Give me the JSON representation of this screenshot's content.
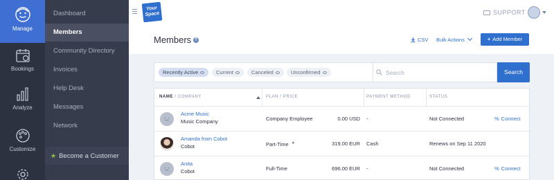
{
  "rail": {
    "items": [
      {
        "label": "Manage",
        "active": true,
        "icon": "face-icon"
      },
      {
        "label": "Bookings",
        "active": false,
        "icon": "calendar-icon"
      },
      {
        "label": "Analyze",
        "active": false,
        "icon": "bar-chart-icon"
      },
      {
        "label": "Customize",
        "active": false,
        "icon": "palette-icon"
      }
    ]
  },
  "sidebar": {
    "items": [
      {
        "label": "Dashboard",
        "active": false
      },
      {
        "label": "Members",
        "active": true
      },
      {
        "label": "Community Directory",
        "active": false
      },
      {
        "label": "Invoices",
        "active": false
      },
      {
        "label": "Help Desk",
        "active": false
      },
      {
        "label": "Messages",
        "active": false
      },
      {
        "label": "Network",
        "active": false
      }
    ],
    "become_customer": "Become a Customer"
  },
  "topbar": {
    "logo_text_line1": "Your",
    "logo_text_line2": "Space",
    "support_label": "SUPPORT"
  },
  "page": {
    "title": "Members",
    "csv_label": "CSV",
    "bulk_label": "Bulk Actions",
    "add_label": "Add Member"
  },
  "filters": {
    "chips": [
      {
        "label": "Recently Active",
        "active": true
      },
      {
        "label": "Current",
        "active": false
      },
      {
        "label": "Canceled",
        "active": false
      },
      {
        "label": "Unconfirmed",
        "active": false
      }
    ],
    "search_placeholder": "Search",
    "search_button": "Search"
  },
  "table": {
    "headers": {
      "name": "NAME",
      "company": "/ COMPANY",
      "plan": "PLAN / PRICE",
      "payment": "PAYMENT METHOD",
      "status": "STATUS"
    },
    "rows": [
      {
        "name": "Acme Music",
        "company": "Music Company",
        "plan": "Company Employee",
        "starred": false,
        "price": "0.00 USD",
        "payment": "-",
        "status": "Not Connected",
        "action": "Connect",
        "photo": false
      },
      {
        "name": "Amanda from Cobot",
        "company": "Cobot",
        "plan": "Part-Time",
        "starred": true,
        "price": "319.00 EUR",
        "payment": "Cash",
        "status": "Renews on Sep 11 2020",
        "action": "",
        "photo": true
      },
      {
        "name": "Anita",
        "company": "Cobot",
        "plan": "Full-Time",
        "starred": false,
        "price": "696.00 EUR",
        "payment": "-",
        "status": "Not Connected",
        "action": "Connect",
        "photo": false
      }
    ],
    "star_glyph": "*",
    "link_glyph": "%"
  },
  "colors": {
    "accent": "#2f6fcd",
    "rail_bg": "#2d3241",
    "sidebar_bg": "#363c4c",
    "page_bg": "#eef2f7"
  }
}
